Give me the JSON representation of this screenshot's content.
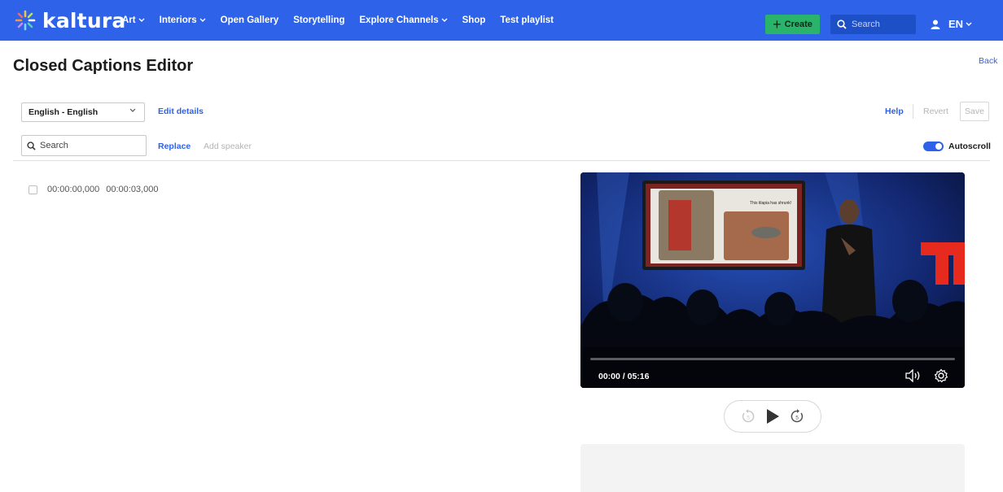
{
  "header": {
    "brand": "kaltura",
    "nav": [
      {
        "label": "Art",
        "dropdown": true
      },
      {
        "label": "Interiors",
        "dropdown": true
      },
      {
        "label": "Open Gallery",
        "dropdown": false
      },
      {
        "label": "Storytelling",
        "dropdown": false
      },
      {
        "label": "Explore Channels",
        "dropdown": true
      },
      {
        "label": "Shop",
        "dropdown": false
      },
      {
        "label": "Test playlist",
        "dropdown": false
      }
    ],
    "create_label": "Create",
    "search_placeholder": "Search",
    "language": "EN"
  },
  "page": {
    "title": "Closed Captions Editor",
    "back_label": "Back"
  },
  "toolbar": {
    "language_select": "English - English",
    "edit_details": "Edit details",
    "help": "Help",
    "revert": "Revert",
    "save": "Save",
    "search_placeholder": "Search",
    "replace": "Replace",
    "add_speaker": "Add speaker",
    "autoscroll_label": "Autoscroll",
    "autoscroll_on": true
  },
  "captions": [
    {
      "start": "00:00:00,000",
      "end": "00:00:03,000",
      "text": ""
    }
  ],
  "player": {
    "time": "00:00 / 05:16",
    "progress": 0,
    "slide_caption": "This tilapia has shrunk!"
  },
  "colors": {
    "brand_blue": "#2d62e9",
    "create_green": "#29b36b"
  },
  "icons": {
    "logo": "kaltura-star-icon",
    "search": "search-icon",
    "user": "user-icon",
    "volume": "volume-icon",
    "settings": "gear-icon",
    "rewind": "rewind-5-icon",
    "play": "play-icon",
    "forward": "forward-5-icon"
  }
}
